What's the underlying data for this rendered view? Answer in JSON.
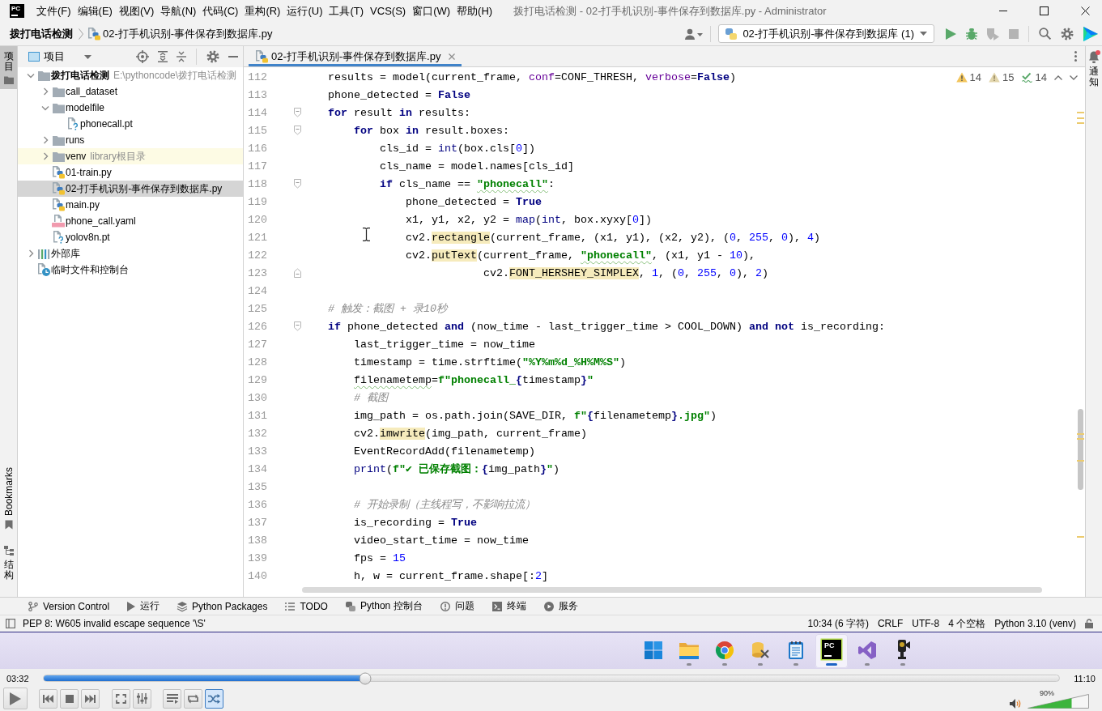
{
  "title_bar": {
    "logo": "PC",
    "menu": [
      "文件(F)",
      "编辑(E)",
      "视图(V)",
      "导航(N)",
      "代码(C)",
      "重构(R)",
      "运行(U)",
      "工具(T)",
      "VCS(S)",
      "窗口(W)",
      "帮助(H)"
    ],
    "title": "拨打电话检测 - 02-打手机识别-事件保存到数据库.py - Administrator"
  },
  "nav_bar": {
    "breadcrumbs": [
      {
        "kind": "project",
        "label": "拨打电话检测"
      },
      {
        "kind": "python",
        "label": "02-打手机识别-事件保存到数据库.py"
      }
    ],
    "run_config": "02-打手机识别-事件保存到数据库 (1)",
    "toolbar": [
      {
        "kind": "run",
        "disabled": false
      },
      {
        "kind": "debug",
        "disabled": false
      },
      {
        "kind": "coverage",
        "disabled": true
      },
      {
        "kind": "stop",
        "disabled": true
      }
    ]
  },
  "left_strip": {
    "top": [
      {
        "kind": "project",
        "label": "项目",
        "selected": true
      }
    ],
    "bottom": [
      {
        "kind": "bookmarks",
        "label": "Bookmarks",
        "selected": false
      },
      {
        "kind": "structure",
        "label": "结构",
        "selected": false
      }
    ]
  },
  "project": {
    "title": "项目",
    "tree": [
      {
        "kind": "project",
        "label": "拨打电话检测",
        "path": "E:\\pythoncode\\拨打电话检测",
        "expanded": true,
        "selected": false,
        "children": [
          {
            "kind": "folder",
            "label": "call_dataset",
            "expanded": false,
            "selected": false
          },
          {
            "kind": "folder",
            "label": "modelfile",
            "expanded": true,
            "selected": false,
            "children": [
              {
                "kind": "unknown",
                "label": "phonecall.pt",
                "selected": false
              }
            ]
          },
          {
            "kind": "folder",
            "label": "runs",
            "expanded": false,
            "selected": false
          },
          {
            "kind": "library-folder",
            "label": "venv",
            "note": "library根目录",
            "expanded": false,
            "selected": false
          },
          {
            "kind": "python",
            "label": "01-train.py",
            "selected": false
          },
          {
            "kind": "python",
            "label": "02-打手机识别-事件保存到数据库.py",
            "selected": true
          },
          {
            "kind": "python",
            "label": "main.py",
            "selected": false
          },
          {
            "kind": "yaml",
            "label": "phone_call.yaml",
            "selected": false
          },
          {
            "kind": "unknown",
            "label": "yolov8n.pt",
            "selected": false
          }
        ]
      },
      {
        "kind": "libraries",
        "label": "外部库",
        "expanded": false,
        "selected": false
      },
      {
        "kind": "scratches",
        "label": "临时文件和控制台",
        "selected": false
      }
    ]
  },
  "editor": {
    "tabs": [
      {
        "label": "02-打手机识别-事件保存到数据库.py",
        "selected": true
      }
    ],
    "inspections": [
      {
        "kind": "warning",
        "count": "14"
      },
      {
        "kind": "weak-warning",
        "count": "15"
      },
      {
        "kind": "typo",
        "count": "14"
      }
    ],
    "lines": [
      {
        "number": "112",
        "kind": "plain",
        "tokens": [
          {
            "kind": "plain",
            "text": "    results = model(current_frame, "
          },
          {
            "kind": "param",
            "text": "conf"
          },
          {
            "kind": "plain",
            "text": "=CONF_THRESH, "
          },
          {
            "kind": "param",
            "text": "verbose"
          },
          {
            "kind": "plain",
            "text": "="
          },
          {
            "kind": "keyword",
            "text": "False"
          },
          {
            "kind": "plain",
            "text": ")"
          }
        ]
      },
      {
        "number": "113",
        "kind": "plain",
        "tokens": [
          {
            "kind": "plain",
            "text": "    phone_detected = "
          },
          {
            "kind": "keyword",
            "text": "False"
          }
        ]
      },
      {
        "number": "114",
        "kind": "opener",
        "tokens": [
          {
            "kind": "keyword",
            "text": "    for"
          },
          {
            "kind": "plain",
            "text": " result "
          },
          {
            "kind": "keyword",
            "text": "in"
          },
          {
            "kind": "plain",
            "text": " results:"
          }
        ]
      },
      {
        "number": "115",
        "kind": "opener",
        "tokens": [
          {
            "kind": "keyword",
            "text": "        for"
          },
          {
            "kind": "plain",
            "text": " box "
          },
          {
            "kind": "keyword",
            "text": "in"
          },
          {
            "kind": "plain",
            "text": " result.boxes:"
          }
        ]
      },
      {
        "number": "116",
        "kind": "plain",
        "tokens": [
          {
            "kind": "plain",
            "text": "            cls_id = "
          },
          {
            "kind": "builtin",
            "text": "int"
          },
          {
            "kind": "plain",
            "text": "(box.cls["
          },
          {
            "kind": "number",
            "text": "0"
          },
          {
            "kind": "plain",
            "text": "])"
          }
        ]
      },
      {
        "number": "117",
        "kind": "plain",
        "tokens": [
          {
            "kind": "plain",
            "text": "            cls_name = model.names[cls_id]"
          }
        ]
      },
      {
        "number": "118",
        "kind": "opener",
        "tokens": [
          {
            "kind": "keyword",
            "text": "            if"
          },
          {
            "kind": "plain",
            "text": " cls_name == "
          },
          {
            "kind": "string-typo",
            "text": "\"phonecall\""
          },
          {
            "kind": "plain",
            "text": ":"
          }
        ]
      },
      {
        "number": "119",
        "kind": "plain",
        "tokens": [
          {
            "kind": "plain",
            "text": "                phone_detected = "
          },
          {
            "kind": "keyword",
            "text": "True"
          }
        ]
      },
      {
        "number": "120",
        "kind": "plain",
        "tokens": [
          {
            "kind": "plain",
            "text": "                x1, y1, x2, y2 = "
          },
          {
            "kind": "builtin",
            "text": "map"
          },
          {
            "kind": "plain",
            "text": "("
          },
          {
            "kind": "builtin",
            "text": "int"
          },
          {
            "kind": "plain",
            "text": ", box.xyxy["
          },
          {
            "kind": "number",
            "text": "0"
          },
          {
            "kind": "plain",
            "text": "])"
          }
        ]
      },
      {
        "number": "121",
        "kind": "plain",
        "tokens": [
          {
            "kind": "plain",
            "text": "                cv2."
          },
          {
            "kind": "marked",
            "text": "rectangle"
          },
          {
            "kind": "plain",
            "text": "(current_frame, (x1, y1), (x2, y2), ("
          },
          {
            "kind": "number",
            "text": "0"
          },
          {
            "kind": "plain",
            "text": ", "
          },
          {
            "kind": "number",
            "text": "255"
          },
          {
            "kind": "plain",
            "text": ", "
          },
          {
            "kind": "number",
            "text": "0"
          },
          {
            "kind": "plain",
            "text": "), "
          },
          {
            "kind": "number",
            "text": "4"
          },
          {
            "kind": "plain",
            "text": ")"
          }
        ]
      },
      {
        "number": "122",
        "kind": "plain",
        "tokens": [
          {
            "kind": "plain",
            "text": "                cv2."
          },
          {
            "kind": "marked",
            "text": "putText"
          },
          {
            "kind": "plain",
            "text": "(current_frame, "
          },
          {
            "kind": "string-typo",
            "text": "\"phonecall\""
          },
          {
            "kind": "plain",
            "text": ", (x1, y1 - "
          },
          {
            "kind": "number",
            "text": "10"
          },
          {
            "kind": "plain",
            "text": "),"
          }
        ]
      },
      {
        "number": "123",
        "kind": "closer",
        "tokens": [
          {
            "kind": "plain",
            "text": "                            cv2."
          },
          {
            "kind": "marked",
            "text": "FONT_HERSHEY_SIMPLEX"
          },
          {
            "kind": "plain",
            "text": ", "
          },
          {
            "kind": "number",
            "text": "1"
          },
          {
            "kind": "plain",
            "text": ", ("
          },
          {
            "kind": "number",
            "text": "0"
          },
          {
            "kind": "plain",
            "text": ", "
          },
          {
            "kind": "number",
            "text": "255"
          },
          {
            "kind": "plain",
            "text": ", "
          },
          {
            "kind": "number",
            "text": "0"
          },
          {
            "kind": "plain",
            "text": "), "
          },
          {
            "kind": "number",
            "text": "2"
          },
          {
            "kind": "plain",
            "text": ")"
          }
        ]
      },
      {
        "number": "124",
        "kind": "plain"
      },
      {
        "number": "125",
        "kind": "plain",
        "tokens": [
          {
            "kind": "comment",
            "text": "    # 触发：截图 + 录10秒"
          }
        ]
      },
      {
        "number": "126",
        "kind": "opener",
        "tokens": [
          {
            "kind": "keyword",
            "text": "    if"
          },
          {
            "kind": "plain",
            "text": " phone_detected "
          },
          {
            "kind": "keyword",
            "text": "and"
          },
          {
            "kind": "plain",
            "text": " (now_time - last_trigger_time > COOL_DOWN) "
          },
          {
            "kind": "keyword",
            "text": "and"
          },
          {
            "kind": "keyword",
            "text": " not"
          },
          {
            "kind": "plain",
            "text": " is_recording:"
          }
        ]
      },
      {
        "number": "127",
        "kind": "plain",
        "tokens": [
          {
            "kind": "plain",
            "text": "        last_trigger_time = now_time"
          }
        ]
      },
      {
        "number": "128",
        "kind": "plain",
        "tokens": [
          {
            "kind": "plain",
            "text": "        timestamp = time.strftime("
          },
          {
            "kind": "string",
            "text": "\"%Y%m%d_%H%M%S\""
          },
          {
            "kind": "plain",
            "text": ")"
          }
        ]
      },
      {
        "number": "129",
        "kind": "plain",
        "tokens": [
          {
            "kind": "typo",
            "text": "        filenametemp"
          },
          {
            "kind": "plain",
            "text": "="
          },
          {
            "kind": "string",
            "text": "f\"phonecall_"
          },
          {
            "kind": "brace",
            "text": "{"
          },
          {
            "kind": "plain",
            "text": "timestamp"
          },
          {
            "kind": "brace",
            "text": "}"
          },
          {
            "kind": "string",
            "text": "\""
          }
        ]
      },
      {
        "number": "130",
        "kind": "plain",
        "tokens": [
          {
            "kind": "comment",
            "text": "        # 截图"
          }
        ]
      },
      {
        "number": "131",
        "kind": "plain",
        "tokens": [
          {
            "kind": "plain",
            "text": "        img_path = os.path.join(SAVE_DIR, "
          },
          {
            "kind": "string",
            "text": "f\""
          },
          {
            "kind": "brace",
            "text": "{"
          },
          {
            "kind": "plain",
            "text": "filenametemp"
          },
          {
            "kind": "brace",
            "text": "}"
          },
          {
            "kind": "string",
            "text": ".jpg\""
          },
          {
            "kind": "plain",
            "text": ")"
          }
        ]
      },
      {
        "number": "132",
        "kind": "plain",
        "tokens": [
          {
            "kind": "plain",
            "text": "        cv2."
          },
          {
            "kind": "marked",
            "text": "imwrite"
          },
          {
            "kind": "plain",
            "text": "(img_path, current_frame)"
          }
        ]
      },
      {
        "number": "133",
        "kind": "plain",
        "tokens": [
          {
            "kind": "plain",
            "text": "        EventRecordAdd(filenametemp)"
          }
        ]
      },
      {
        "number": "134",
        "kind": "plain",
        "tokens": [
          {
            "kind": "builtin",
            "text": "        print"
          },
          {
            "kind": "plain",
            "text": "("
          },
          {
            "kind": "string",
            "text": "f\"✔ 已保存截图："
          },
          {
            "kind": "brace",
            "text": "{"
          },
          {
            "kind": "plain",
            "text": "img_path"
          },
          {
            "kind": "brace",
            "text": "}"
          },
          {
            "kind": "string",
            "text": "\""
          },
          {
            "kind": "plain",
            "text": ")"
          }
        ]
      },
      {
        "number": "135",
        "kind": "plain"
      },
      {
        "number": "136",
        "kind": "plain",
        "tokens": [
          {
            "kind": "comment",
            "text": "        # 开始录制（主线程写，不影响拉流）"
          }
        ]
      },
      {
        "number": "137",
        "kind": "plain",
        "tokens": [
          {
            "kind": "plain",
            "text": "        is_recording = "
          },
          {
            "kind": "keyword",
            "text": "True"
          }
        ]
      },
      {
        "number": "138",
        "kind": "plain",
        "tokens": [
          {
            "kind": "plain",
            "text": "        video_start_time = now_time"
          }
        ]
      },
      {
        "number": "139",
        "kind": "plain",
        "tokens": [
          {
            "kind": "plain",
            "text": "        fps = "
          },
          {
            "kind": "number",
            "text": "15"
          }
        ]
      },
      {
        "number": "140",
        "kind": "plain",
        "tokens": [
          {
            "kind": "plain",
            "text": "        h, w = current_frame.shape[:"
          },
          {
            "kind": "number",
            "text": "2"
          },
          {
            "kind": "plain",
            "text": "]"
          }
        ]
      }
    ]
  },
  "right_strip": {
    "label": "通知",
    "unread": true
  },
  "tool_windows": [
    {
      "kind": "vcs",
      "label": "Version Control"
    },
    {
      "kind": "run",
      "label": "运行"
    },
    {
      "kind": "packages",
      "label": "Python Packages"
    },
    {
      "kind": "todo",
      "label": "TODO"
    },
    {
      "kind": "console",
      "label": "Python 控制台"
    },
    {
      "kind": "problems",
      "label": "问题"
    },
    {
      "kind": "terminal",
      "label": "终端"
    },
    {
      "kind": "services",
      "label": "服务"
    }
  ],
  "status_bar": {
    "message": "PEP 8: W605 invalid escape sequence '\\S'",
    "items": [
      "10:34 (6 字符)",
      "CRLF",
      "UTF-8",
      "4 个空格",
      "Python 3.10 (venv)"
    ]
  },
  "taskbar": {
    "apps": [
      {
        "kind": "start",
        "selected": false,
        "running": false
      },
      {
        "kind": "files",
        "selected": false,
        "running": true
      },
      {
        "kind": "browser",
        "selected": false,
        "running": true
      },
      {
        "kind": "tools",
        "selected": false,
        "running": true
      },
      {
        "kind": "notepad",
        "selected": false,
        "running": true
      },
      {
        "kind": "ide",
        "logo": "PC",
        "selected": true,
        "running": true
      },
      {
        "kind": "studio",
        "selected": false,
        "running": true
      },
      {
        "kind": "camera",
        "selected": false,
        "running": true
      }
    ]
  },
  "player": {
    "elapsed": "03:32",
    "total": "11:10",
    "seek": {
      "level": 0.317
    },
    "buttons": [
      {
        "kind": "play",
        "selected": false
      },
      {
        "kind": "previous",
        "selected": false
      },
      {
        "kind": "stop",
        "selected": false
      },
      {
        "kind": "next",
        "selected": false
      },
      {
        "kind": "fullscreen",
        "selected": false
      },
      {
        "kind": "extended",
        "selected": false
      },
      {
        "kind": "playlist",
        "selected": false
      },
      {
        "kind": "loop",
        "selected": false
      },
      {
        "kind": "random",
        "selected": true
      }
    ],
    "volume": {
      "label": "90%",
      "level": 0.72
    }
  }
}
